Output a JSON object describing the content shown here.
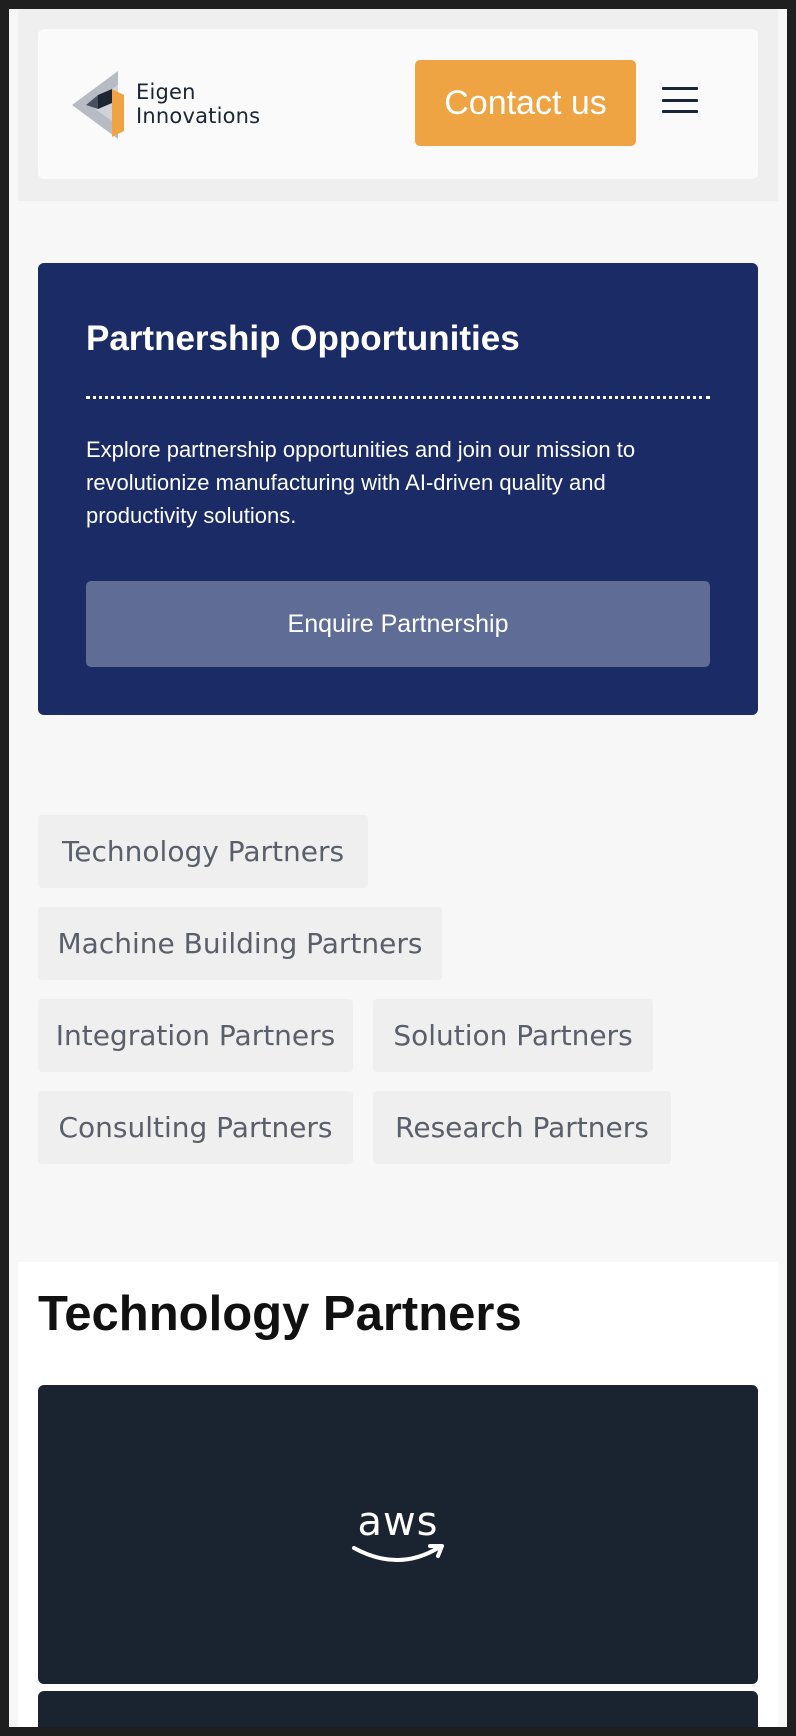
{
  "header": {
    "logo_line1": "Eigen",
    "logo_line2": "Innovations",
    "contact_label": "Contact us",
    "colors": {
      "accent": "#efa443",
      "text": "#1b2533"
    }
  },
  "partnership": {
    "title": "Partnership Opportunities",
    "description": "Explore partnership opportunities and join our mission to revolutionize manufacturing with AI-driven quality and productivity solutions.",
    "button_label": "Enquire Partnership",
    "colors": {
      "card": "#1a2b66",
      "button": "#5f6d96"
    }
  },
  "categories": [
    "Technology Partners",
    "Machine Building Partners",
    "Integration Partners",
    "Solution Partners",
    "Consulting Partners",
    "Research Partners"
  ],
  "tech_section": {
    "title": "Technology Partners",
    "partners": [
      {
        "logo_text": "aws",
        "icon": "aws-logo-icon"
      },
      {
        "logo_text": "",
        "icon": "partner-logo-icon"
      }
    ],
    "colors": {
      "card": "#1a2431"
    }
  }
}
